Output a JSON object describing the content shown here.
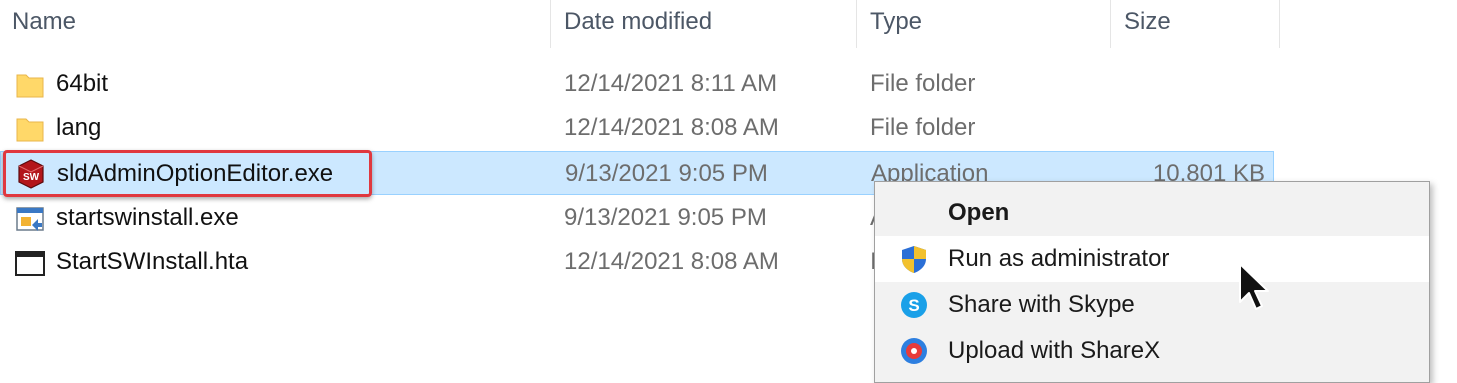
{
  "columns": {
    "name": "Name",
    "date": "Date modified",
    "type": "Type",
    "size": "Size"
  },
  "rows": [
    {
      "name": "64bit",
      "date": "12/14/2021 8:11 AM",
      "type": "File folder",
      "size": "",
      "icon": "folder-icon"
    },
    {
      "name": "lang",
      "date": "12/14/2021 8:08 AM",
      "type": "File folder",
      "size": "",
      "icon": "folder-icon"
    },
    {
      "name": "sldAdminOptionEditor.exe",
      "date": "9/13/2021 9:05 PM",
      "type": "Application",
      "size": "10,801 KB",
      "icon": "solidworks-app-icon",
      "selected": true
    },
    {
      "name": "startswinstall.exe",
      "date": "9/13/2021 9:05 PM",
      "type": "A",
      "size": "",
      "icon": "installer-exe-icon"
    },
    {
      "name": "StartSWInstall.hta",
      "date": "12/14/2021 8:08 AM",
      "type": "I",
      "size": "",
      "icon": "hta-window-icon"
    }
  ],
  "context_menu": {
    "items": [
      {
        "label": "Open",
        "icon": "",
        "bold": true
      },
      {
        "label": "Run as administrator",
        "icon": "uac-shield-icon",
        "hover": true
      },
      {
        "label": "Share with Skype",
        "icon": "skype-icon"
      },
      {
        "label": "Upload with ShareX",
        "icon": "sharex-icon"
      }
    ]
  },
  "colors": {
    "selection": "#cce8ff",
    "highlight_border": "#e0383f",
    "folder": "#ffd869"
  }
}
